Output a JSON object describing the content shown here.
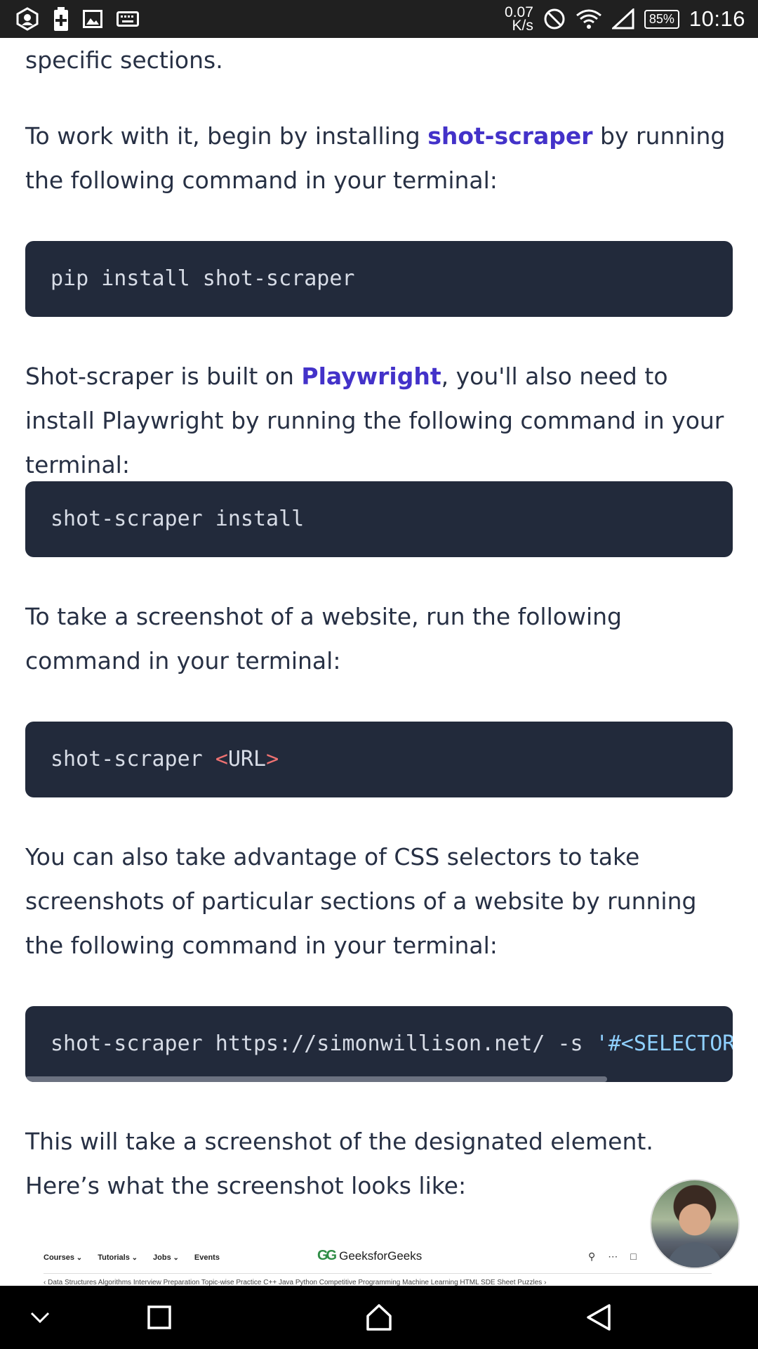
{
  "status_bar": {
    "net_speed_value": "0.07",
    "net_speed_unit": "K/s",
    "battery": "85%",
    "time": "10:16",
    "left_icons": [
      "app-notification-icon",
      "battery-saver-icon",
      "image-icon",
      "keyboard-icon"
    ],
    "right_icons": [
      "do-not-disturb-icon",
      "wifi-icon",
      "signal-icon"
    ]
  },
  "article": {
    "p0": "specific sections.",
    "p1_before": "To work with it, begin by installing ",
    "p1_link": "shot-scraper",
    "p1_after": " by running the following command in your terminal:",
    "code1": "pip install shot-scraper",
    "p2_before": "Shot-scraper is built on ",
    "p2_link": "Playwright",
    "p2_after": ", you'll also need to install Playwright by running the following command in your terminal:",
    "code2": "shot-scraper install",
    "p3": "To take a screenshot of a website, run the following command in your terminal:",
    "code3_cmd": "shot-scraper ",
    "code3_lt": "<",
    "code3_arg": "URL",
    "code3_gt": ">",
    "p4": "You can also take advantage of CSS selectors to take screenshots of particular sections of a website by running the following command in your terminal:",
    "code4_cmd": "shot-scraper https://simonwillison.net/ -s ",
    "code4_str": "'#<SELECTOR>'",
    "p5": "This will take a screenshot of the designated element. Here’s what the screenshot looks like:"
  },
  "preview": {
    "nav": [
      "Courses",
      "Tutorials",
      "Jobs",
      "Events"
    ],
    "logo_mark": "GG",
    "logo_text": "GeeksforGeeks",
    "sub_nav": "‹ Data Structures   Algorithms   Interview Preparation   Topic-wise Practice   C++   Java   Python   Competitive Programming   Machine Learning   HTML   SDE Sheet   Puzzles ›"
  },
  "colors": {
    "text": "#273044",
    "link": "#4332c9",
    "code_bg": "#222a3b",
    "code_text": "#d7dce6",
    "status_bar": "#202020",
    "nav_bar": "#000000"
  }
}
